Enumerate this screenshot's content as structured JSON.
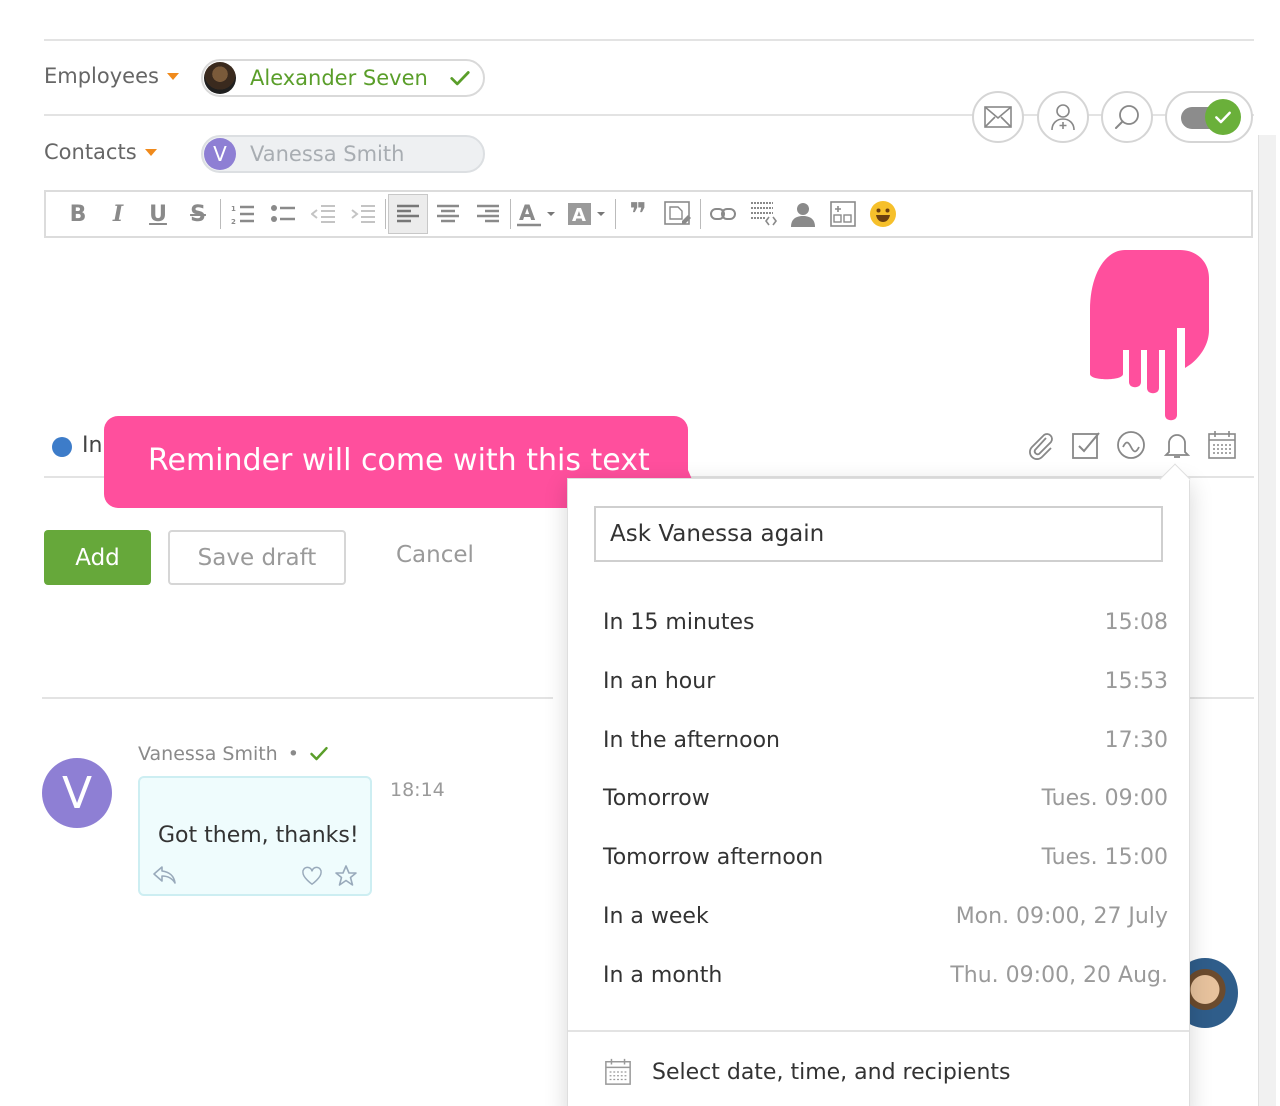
{
  "employees": {
    "label": "Employees",
    "selected": "Alexander Seven"
  },
  "contacts": {
    "label": "Contacts",
    "selected": "Vanessa Smith",
    "initial": "V"
  },
  "editor": {
    "in_label": "In"
  },
  "callout": {
    "text": "Reminder will come with this text"
  },
  "actions": {
    "add": "Add",
    "save_draft": "Save draft",
    "cancel": "Cancel"
  },
  "message": {
    "author": "Vanessa Smith",
    "bullet": "•",
    "text": "Got them, thanks!",
    "time": "18:14",
    "initial": "V"
  },
  "reminder": {
    "text": "Ask Vanessa again",
    "options": [
      {
        "label": "In 15 minutes",
        "time": "15:08"
      },
      {
        "label": "In an hour",
        "time": "15:53"
      },
      {
        "label": "In the afternoon",
        "time": "17:30"
      },
      {
        "label": "Tomorrow",
        "time": "Tues. 09:00"
      },
      {
        "label": "Tomorrow afternoon",
        "time": "Tues. 15:00"
      },
      {
        "label": "In a week",
        "time": "Mon. 09:00, 27 July"
      },
      {
        "label": "In a month",
        "time": "Thu. 09:00, 20 Aug."
      }
    ],
    "custom": "Select date, time, and recipients"
  },
  "colors": {
    "accent_green": "#66a83a",
    "callout_pink": "#ff4f9d",
    "caret_orange": "#f08a1c",
    "avatar_purple": "#8e7fd4"
  }
}
